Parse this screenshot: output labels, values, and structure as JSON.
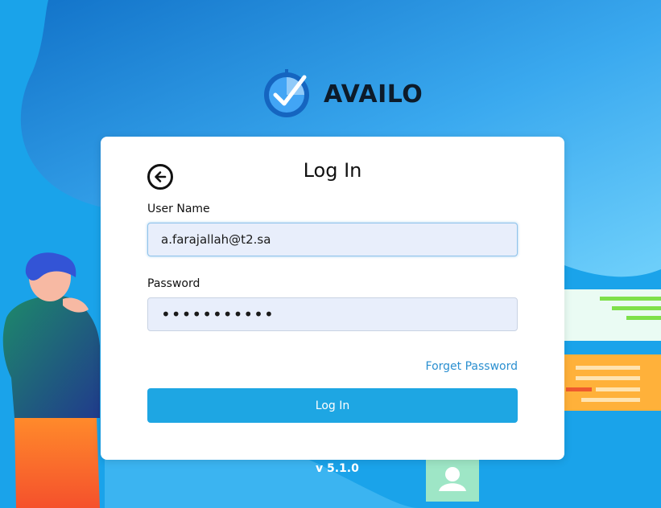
{
  "brand": {
    "name": "AVAILO",
    "icon": "clock-check-icon"
  },
  "login": {
    "title": "Log In",
    "back_icon": "arrow-left-circle-icon",
    "username_label": "User Name",
    "username_value": "a.farajallah@t2.sa",
    "password_label": "Password",
    "password_value": "•••••••••••",
    "forget_password": "Forget Password",
    "submit_label": "Log In"
  },
  "version": "v 5.1.0",
  "colors": {
    "background": "#1a9ee6",
    "accent": "#1ea6e3",
    "link": "#2a8fd0",
    "input_bg": "#e8eefb"
  }
}
